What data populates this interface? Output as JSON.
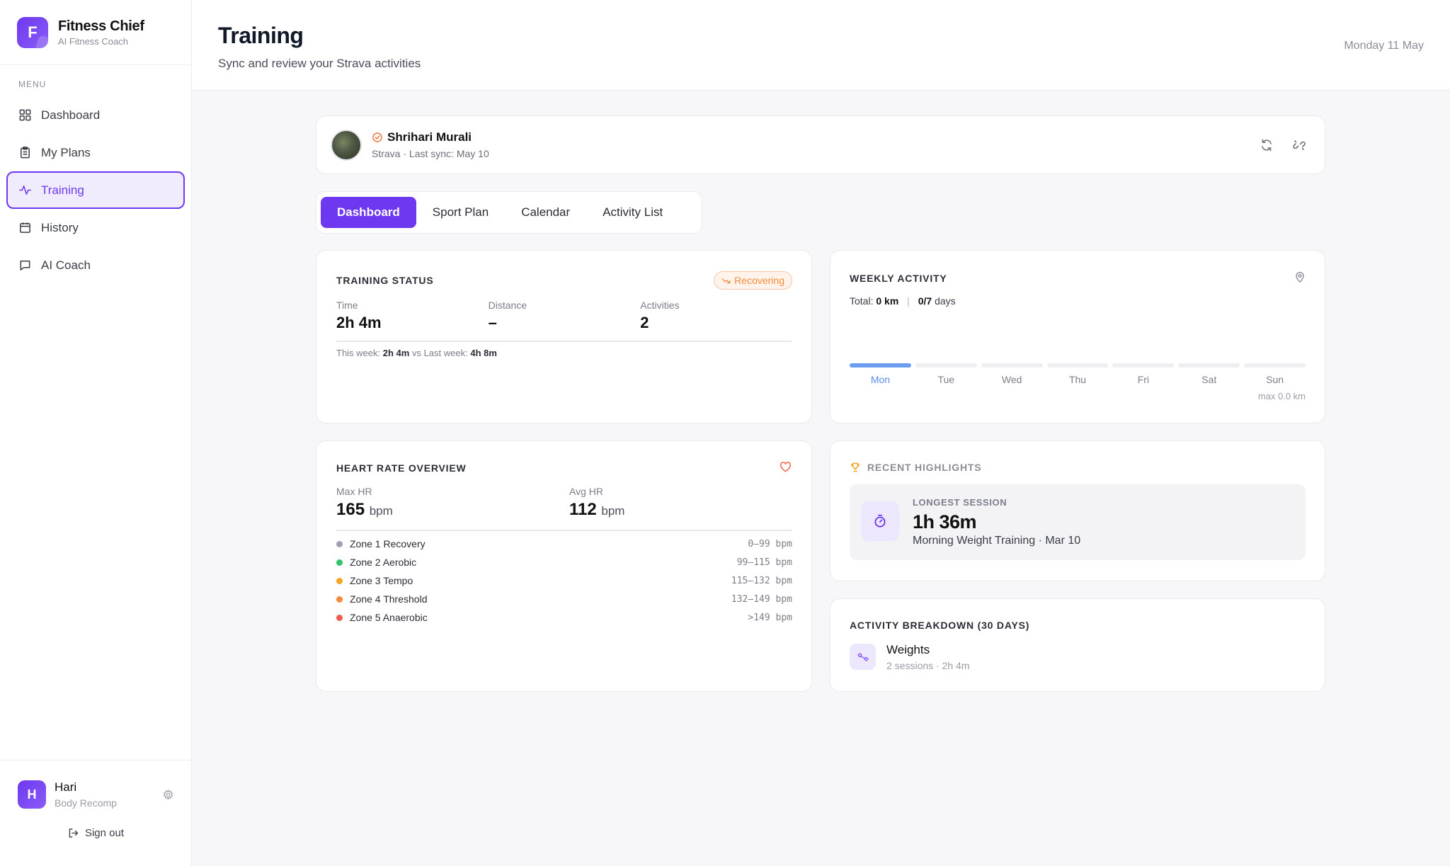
{
  "brand": {
    "logo_letter": "F",
    "name": "Fitness Chief",
    "subtitle": "AI Fitness Coach"
  },
  "sidebar": {
    "menu_label": "MENU",
    "items": [
      {
        "label": "Dashboard",
        "icon": "grid-icon"
      },
      {
        "label": "My Plans",
        "icon": "clipboard-icon"
      },
      {
        "label": "Training",
        "icon": "activity-icon",
        "active": true
      },
      {
        "label": "History",
        "icon": "calendar-icon"
      },
      {
        "label": "AI Coach",
        "icon": "chat-icon"
      }
    ],
    "user": {
      "initial": "H",
      "name": "Hari",
      "subtitle": "Body Recomp"
    },
    "sign_out": "Sign out"
  },
  "header": {
    "title": "Training",
    "subtitle": "Sync and review your Strava activities",
    "date": "Monday 11 May"
  },
  "profile": {
    "name": "Shrihari Murali",
    "subtitle": "Strava · Last sync: May 10"
  },
  "tabs": [
    {
      "label": "Dashboard",
      "active": true
    },
    {
      "label": "Sport Plan"
    },
    {
      "label": "Calendar"
    },
    {
      "label": "Activity List"
    }
  ],
  "training_status": {
    "title": "TRAINING STATUS",
    "badge": "Recovering",
    "stats": [
      {
        "label": "Time",
        "value": "2h 4m"
      },
      {
        "label": "Distance",
        "value": "–"
      },
      {
        "label": "Activities",
        "value": "2"
      }
    ],
    "week_prefix": "This week:",
    "week_value": "2h 4m",
    "week_middle": "vs Last week:",
    "last_week_value": "4h 8m"
  },
  "weekly_activity": {
    "title": "WEEKLY ACTIVITY",
    "total_label": "Total:",
    "total_value": "0 km",
    "days_value": "0/7",
    "days_label": "days",
    "days": [
      "Mon",
      "Tue",
      "Wed",
      "Thu",
      "Fri",
      "Sat",
      "Sun"
    ],
    "active_day": "Mon",
    "max_label": "max 0.0 km"
  },
  "heart_rate": {
    "title": "HEART RATE OVERVIEW",
    "max_label": "Max HR",
    "max_value": "165",
    "avg_label": "Avg HR",
    "avg_value": "112",
    "unit": "bpm",
    "zones": [
      {
        "name": "Zone 1 Recovery",
        "range": "0–99 bpm",
        "color": "#9ca3af"
      },
      {
        "name": "Zone 2 Aerobic",
        "range": "99–115 bpm",
        "color": "#34c26b"
      },
      {
        "name": "Zone 3 Tempo",
        "range": "115–132 bpm",
        "color": "#f5a524"
      },
      {
        "name": "Zone 4 Threshold",
        "range": "132–149 bpm",
        "color": "#f7893b"
      },
      {
        "name": "Zone 5 Anaerobic",
        "range": ">149 bpm",
        "color": "#ef5a4f"
      }
    ]
  },
  "highlights": {
    "title": "RECENT HIGHLIGHTS",
    "label": "LONGEST SESSION",
    "value": "1h 36m",
    "description": "Morning Weight Training · Mar 10"
  },
  "breakdown": {
    "title": "ACTIVITY BREAKDOWN (30 DAYS)",
    "items": [
      {
        "name": "Weights",
        "detail": "2 sessions · 2h 4m"
      }
    ]
  },
  "colors": {
    "accent": "#6d38f0",
    "badge": "#f08c3c",
    "weekday_active": "#6a9cf0"
  }
}
